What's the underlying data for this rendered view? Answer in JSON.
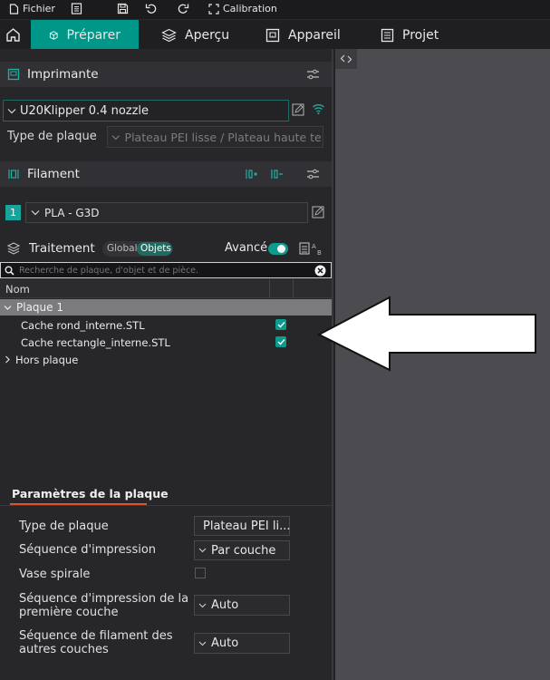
{
  "menu": {
    "file_label": "Fichier",
    "calibration_label": "Calibration"
  },
  "tabs": [
    {
      "label": "Préparer"
    },
    {
      "label": "Aperçu"
    },
    {
      "label": "Appareil"
    },
    {
      "label": "Projet"
    }
  ],
  "printer": {
    "header": "Imprimante",
    "selected": "U20Klipper 0.4 nozzle",
    "plate_type_label": "Type de plaque",
    "plate_type_value": "Plateau PEI lisse / Plateau haute te..."
  },
  "filament": {
    "header": "Filament",
    "slot_number": "1",
    "selected": "PLA - G3D",
    "slot_color": "#1aa39a"
  },
  "process": {
    "header": "Traitement",
    "toggle_global": "Global",
    "toggle_objects": "Objets",
    "advanced_label": "Avancé"
  },
  "objects": {
    "search_placeholder": "Recherche de plaque, d'objet et de pièce.",
    "column_name": "Nom",
    "plate_label": "Plaque 1",
    "items": [
      {
        "name": "Cache rond_interne.STL",
        "checked": true
      },
      {
        "name": "Cache rectangle_interne.STL",
        "checked": true
      }
    ],
    "off_plate_label": "Hors plaque"
  },
  "plate_params": {
    "tab_label": "Paramètres de la plaque",
    "rows": [
      {
        "label": "Type de plaque",
        "value": "Plateau PEI li..."
      },
      {
        "label": "Séquence d'impression",
        "value": "Par couche"
      },
      {
        "label": "Vase spirale",
        "value": ""
      },
      {
        "label_line1": "Séquence d'impression de la",
        "label_line2": "première couche",
        "value": "Auto"
      },
      {
        "label_line1": "Séquence de filament des",
        "label_line2": "autres couches",
        "value": "Auto"
      }
    ]
  },
  "colors": {
    "accent": "#009688",
    "check": "#0d9b8d",
    "viewport": "#4b4b50"
  }
}
